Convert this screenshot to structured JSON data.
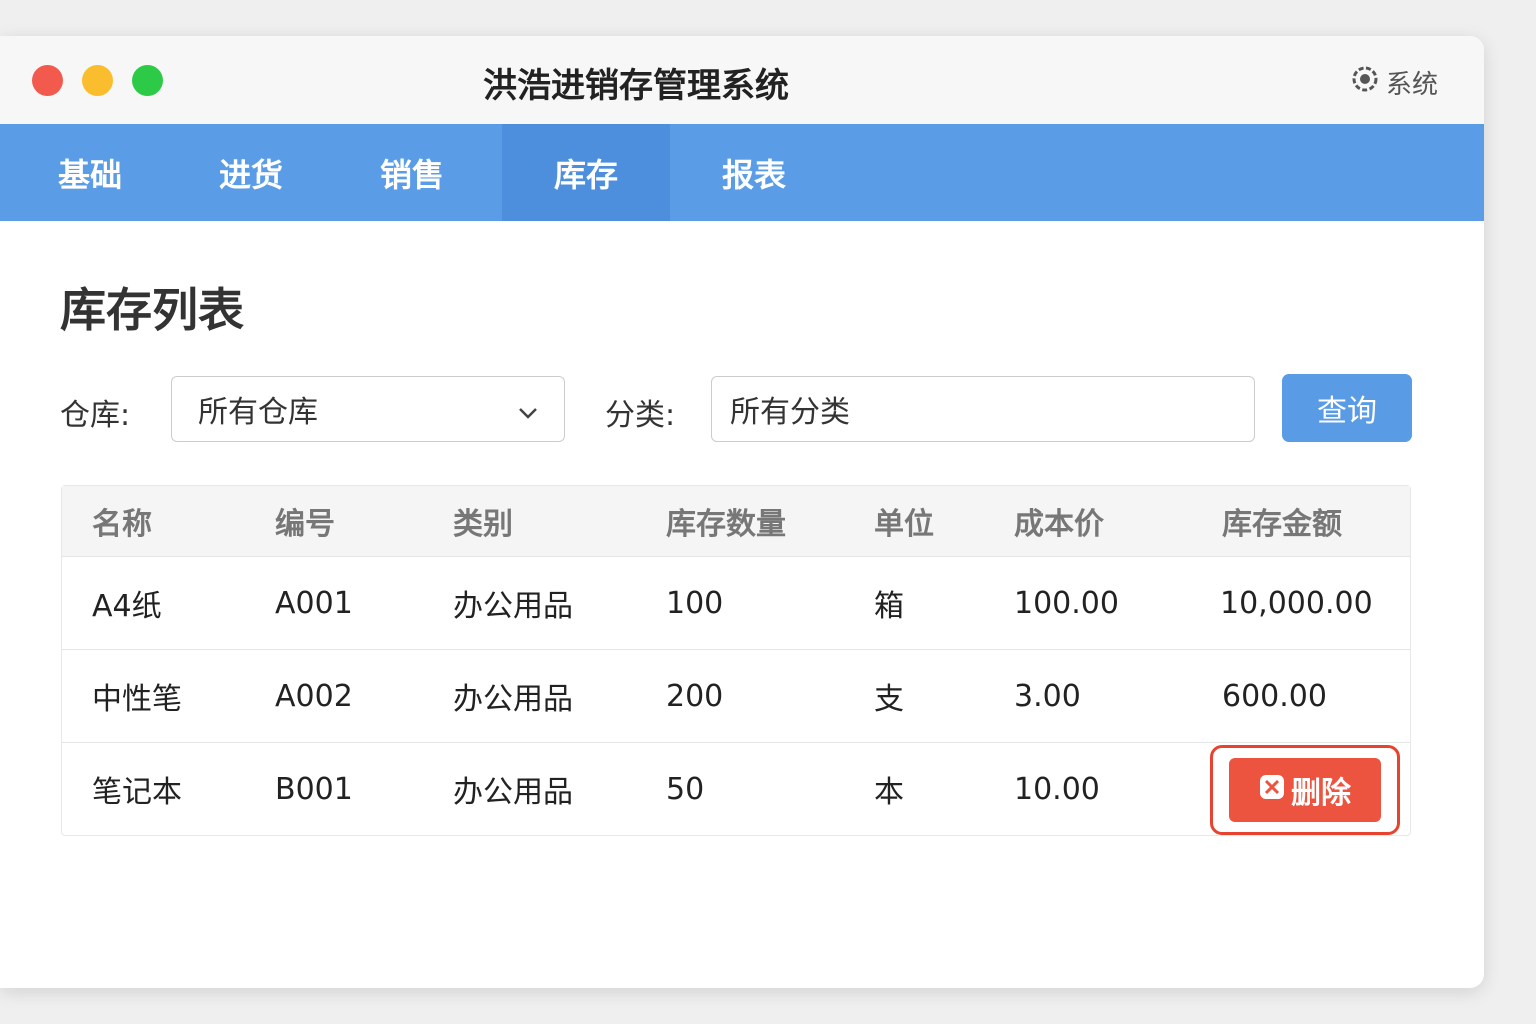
{
  "window": {
    "title": "洪浩进销存管理系统",
    "system_label": "系统"
  },
  "nav": {
    "tabs": [
      {
        "label": "基础"
      },
      {
        "label": "进货"
      },
      {
        "label": "销售"
      },
      {
        "label": "库存",
        "active": true
      },
      {
        "label": "报表"
      }
    ]
  },
  "page": {
    "heading": "库存列表"
  },
  "filters": {
    "warehouse_label": "仓库:",
    "warehouse_value": "所有仓库",
    "category_label": "分类:",
    "category_value": "所有分类",
    "query_button": "查询"
  },
  "table": {
    "headers": [
      "名称",
      "编号",
      "类别",
      "库存数量",
      "单位",
      "成本价",
      "库存金额"
    ],
    "rows": [
      [
        "A4纸",
        "A001",
        "办公用品",
        "100",
        "箱",
        "100.00",
        "10,000.00"
      ],
      [
        "中性笔",
        "A002",
        "办公用品",
        "200",
        "支",
        "3.00",
        "600.00"
      ],
      [
        "笔记本",
        "B001",
        "办公用品",
        "50",
        "本",
        "10.00",
        ""
      ]
    ],
    "delete_label": "删除"
  },
  "colors": {
    "nav": "#5b9ce7",
    "danger": "#ec5440"
  }
}
